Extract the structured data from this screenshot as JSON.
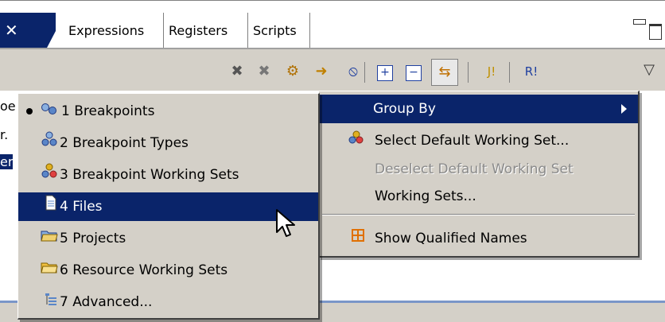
{
  "view": {
    "tabs": [
      {
        "label": "Expressions"
      },
      {
        "label": "Registers"
      },
      {
        "label": "Scripts"
      }
    ],
    "active_tab_close": "✕",
    "toolbar_icons": [
      "remove-breakpoint-icon",
      "remove-all-breakpoints-icon",
      "link-with-debug-view-icon",
      "go-to-file-icon",
      "skip-all-breakpoints-icon",
      "expand-all-icon",
      "collapse-all-icon",
      "link-with-editor-icon",
      "add-java-exception-breakpoint-icon",
      "add-breakpoint-icon",
      "view-menu-icon"
    ],
    "content_snippets": [
      "oe",
      "r.",
      "er"
    ]
  },
  "main_menu": {
    "items": [
      {
        "label": "Group By",
        "selected": true,
        "has_submenu": true
      },
      {
        "label": "Select Default Working Set...",
        "icon": "working-set-icon"
      },
      {
        "label": "Deselect Default Working Set",
        "disabled": true
      },
      {
        "label": "Working Sets..."
      },
      {
        "label": "Show Qualified Names",
        "icon": "qualified-names-icon"
      }
    ]
  },
  "group_by_menu": {
    "items": [
      {
        "label": "1 Breakpoints",
        "icon": "breakpoints-icon",
        "checked": true
      },
      {
        "label": "2 Breakpoint Types",
        "icon": "breakpoint-types-icon"
      },
      {
        "label": "3 Breakpoint Working Sets",
        "icon": "breakpoint-working-sets-icon"
      },
      {
        "label": "4 Files",
        "icon": "file-icon",
        "selected": true
      },
      {
        "label": "5 Projects",
        "icon": "project-folder-icon"
      },
      {
        "label": "6 Resource Working Sets",
        "icon": "resource-folder-icon"
      },
      {
        "label": "7 Advanced...",
        "icon": "advanced-icon"
      }
    ]
  },
  "colors": {
    "selection": "#0a246a",
    "menu_bg": "#d4d0c8",
    "disabled_text": "#8a8a8a"
  }
}
